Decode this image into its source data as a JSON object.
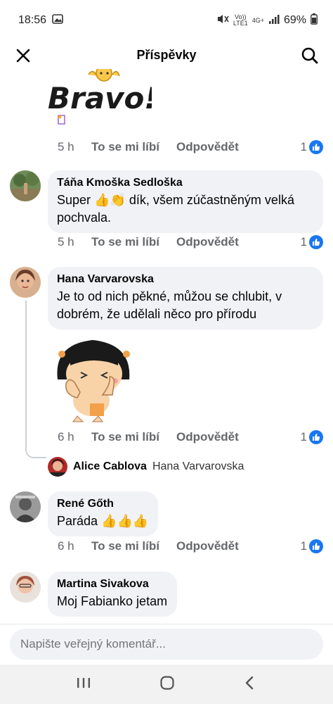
{
  "status_bar": {
    "time": "18:56",
    "volte": "Vo))",
    "lte": "LTE1",
    "network": "4G+",
    "battery": "69%"
  },
  "header": {
    "title": "Příspěvky"
  },
  "sticker_top": {
    "text": "Bravo!"
  },
  "comments": [
    {
      "time": "5 h",
      "like_label": "To se mi líbí",
      "reply_label": "Odpovědět",
      "reactions": "1"
    },
    {
      "author": "Táňa Kmoška Sedloška",
      "text": "Super 👍👏 dík, všem zúčastněným velká pochvala.",
      "time": "5 h",
      "like_label": "To se mi líbí",
      "reply_label": "Odpovědět",
      "reactions": "1"
    },
    {
      "author": "Hana Varvarovska",
      "text": "Je to od nich pěkné, můžou se chlubit, v dobrém, že udělali něco pro přírodu",
      "time": "6 h",
      "like_label": "To se mi líbí",
      "reply_label": "Odpovědět",
      "reactions": "1",
      "reply_preview": {
        "author": "Alice Cablova",
        "text": "Hana Varvarovska"
      }
    },
    {
      "author": "René Gőth",
      "text": "Paráda 👍👍👍",
      "time": "6 h",
      "like_label": "To se mi líbí",
      "reply_label": "Odpovědět",
      "reactions": "1"
    },
    {
      "author": "Martina Sivakova",
      "text": "Moj Fabianko jetam"
    }
  ],
  "composer": {
    "placeholder": "Napište veřejný komentář..."
  },
  "colors": {
    "accent": "#1877f2",
    "bubble": "#f0f2f5",
    "secondary_text": "#65676b"
  }
}
